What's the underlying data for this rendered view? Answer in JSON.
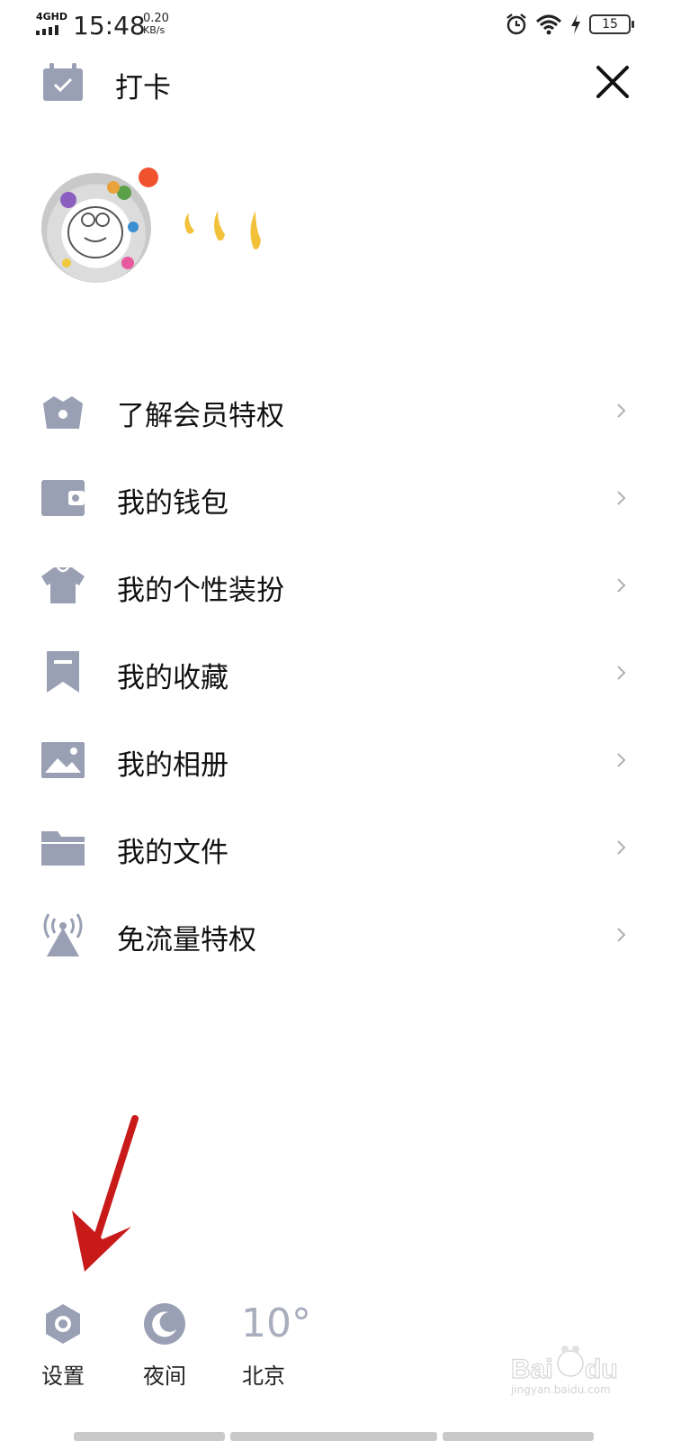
{
  "status_bar": {
    "network": "4GHD",
    "time": "15:48",
    "speed_value": "0.20",
    "speed_unit": "KB/s",
    "battery": "15"
  },
  "header": {
    "checkin_label": "打卡"
  },
  "menu": {
    "items": [
      {
        "label": "了解会员特权",
        "icon": "crown-icon"
      },
      {
        "label": "我的钱包",
        "icon": "wallet-icon"
      },
      {
        "label": "我的个性装扮",
        "icon": "tshirt-icon"
      },
      {
        "label": "我的收藏",
        "icon": "bookmark-icon"
      },
      {
        "label": "我的相册",
        "icon": "photo-icon"
      },
      {
        "label": "我的文件",
        "icon": "folder-icon"
      },
      {
        "label": "免流量特权",
        "icon": "signal-tower-icon"
      }
    ]
  },
  "bottom": {
    "settings_label": "设置",
    "night_label": "夜间",
    "temperature": "10°",
    "city": "北京"
  },
  "watermark": {
    "text": "jingyan.baidu.com"
  },
  "colors": {
    "icon": "#9aa0b4",
    "chevron": "#b0b0b0",
    "arrow": "#c91a1a"
  }
}
